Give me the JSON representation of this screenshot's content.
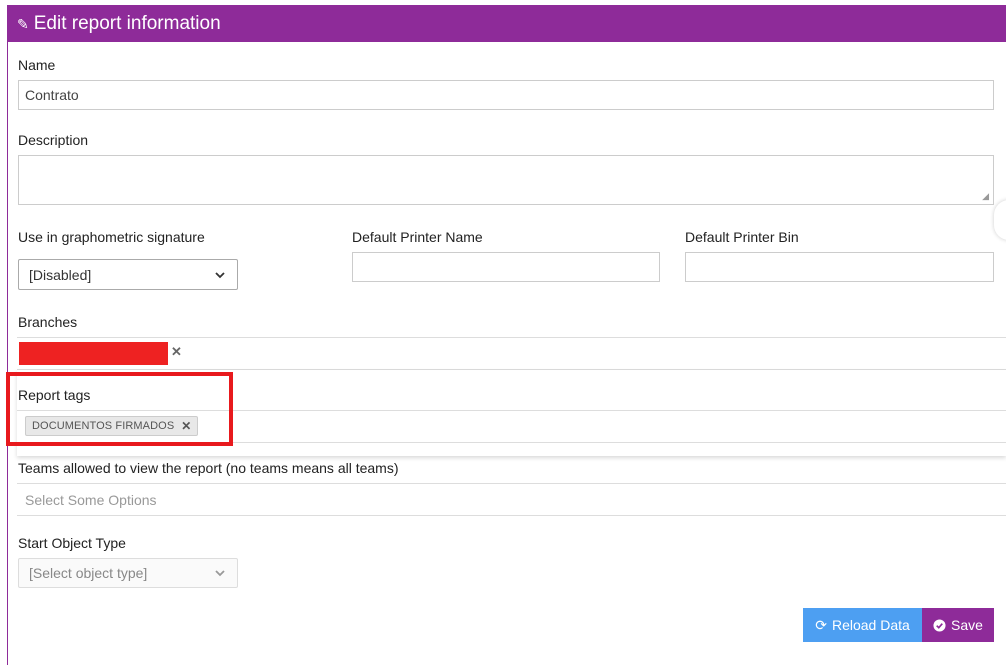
{
  "header": {
    "title": "Edit report information",
    "icon": "pencil-icon"
  },
  "fields": {
    "name": {
      "label": "Name",
      "value": "Contrato"
    },
    "description": {
      "label": "Description",
      "value": ""
    },
    "graphometric": {
      "label": "Use in graphometric signature",
      "value": "[Disabled]"
    },
    "printer_name": {
      "label": "Default Printer Name",
      "value": ""
    },
    "printer_bin": {
      "label": "Default Printer Bin",
      "value": ""
    },
    "branches": {
      "label": "Branches"
    },
    "report_tags": {
      "label": "Report tags",
      "tags": [
        "DOCUMENTOS FIRMADOS"
      ]
    },
    "teams": {
      "label": "Teams allowed to view the report (no teams means all teams)",
      "placeholder": "Select Some Options"
    },
    "start_object": {
      "label": "Start Object Type",
      "value": "[Select object type]"
    }
  },
  "buttons": {
    "reload": "Reload Data",
    "save": "Save"
  },
  "colors": {
    "accent": "#8e2b99",
    "reload": "#4d9ff2",
    "highlight": "#e8191d",
    "redacted": "#ee2222"
  }
}
